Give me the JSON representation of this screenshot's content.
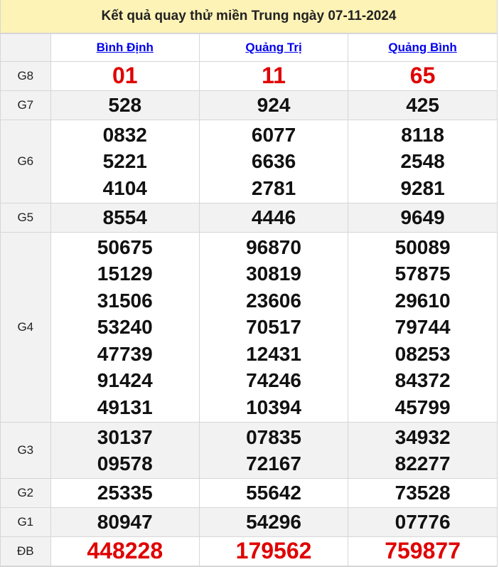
{
  "title": "Kết quả quay thử miền Trung ngày 07-11-2024",
  "provinces": [
    "Bình Định",
    "Quảng Trị",
    "Quảng Bình"
  ],
  "prizes": [
    {
      "label": "G8",
      "values": [
        [
          "01"
        ],
        [
          "11"
        ],
        [
          "65"
        ]
      ]
    },
    {
      "label": "G7",
      "values": [
        [
          "528"
        ],
        [
          "924"
        ],
        [
          "425"
        ]
      ]
    },
    {
      "label": "G6",
      "values": [
        [
          "0832",
          "5221",
          "4104"
        ],
        [
          "6077",
          "6636",
          "2781"
        ],
        [
          "8118",
          "2548",
          "9281"
        ]
      ]
    },
    {
      "label": "G5",
      "values": [
        [
          "8554"
        ],
        [
          "4446"
        ],
        [
          "9649"
        ]
      ]
    },
    {
      "label": "G4",
      "values": [
        [
          "50675",
          "15129",
          "31506",
          "53240",
          "47739",
          "91424",
          "49131"
        ],
        [
          "96870",
          "30819",
          "23606",
          "70517",
          "12431",
          "74246",
          "10394"
        ],
        [
          "50089",
          "57875",
          "29610",
          "79744",
          "08253",
          "84372",
          "45799"
        ]
      ]
    },
    {
      "label": "G3",
      "values": [
        [
          "30137",
          "09578"
        ],
        [
          "07835",
          "72167"
        ],
        [
          "34932",
          "82277"
        ]
      ]
    },
    {
      "label": "G2",
      "values": [
        [
          "25335"
        ],
        [
          "55642"
        ],
        [
          "73528"
        ]
      ]
    },
    {
      "label": "G1",
      "values": [
        [
          "80947"
        ],
        [
          "54296"
        ],
        [
          "07776"
        ]
      ]
    },
    {
      "label": "ĐB",
      "values": [
        [
          "448228"
        ],
        [
          "179562"
        ],
        [
          "759877"
        ]
      ]
    }
  ],
  "colors": {
    "accent_red": "#e00000",
    "header_bg": "#fdf3b6",
    "link": "#0000ee"
  }
}
